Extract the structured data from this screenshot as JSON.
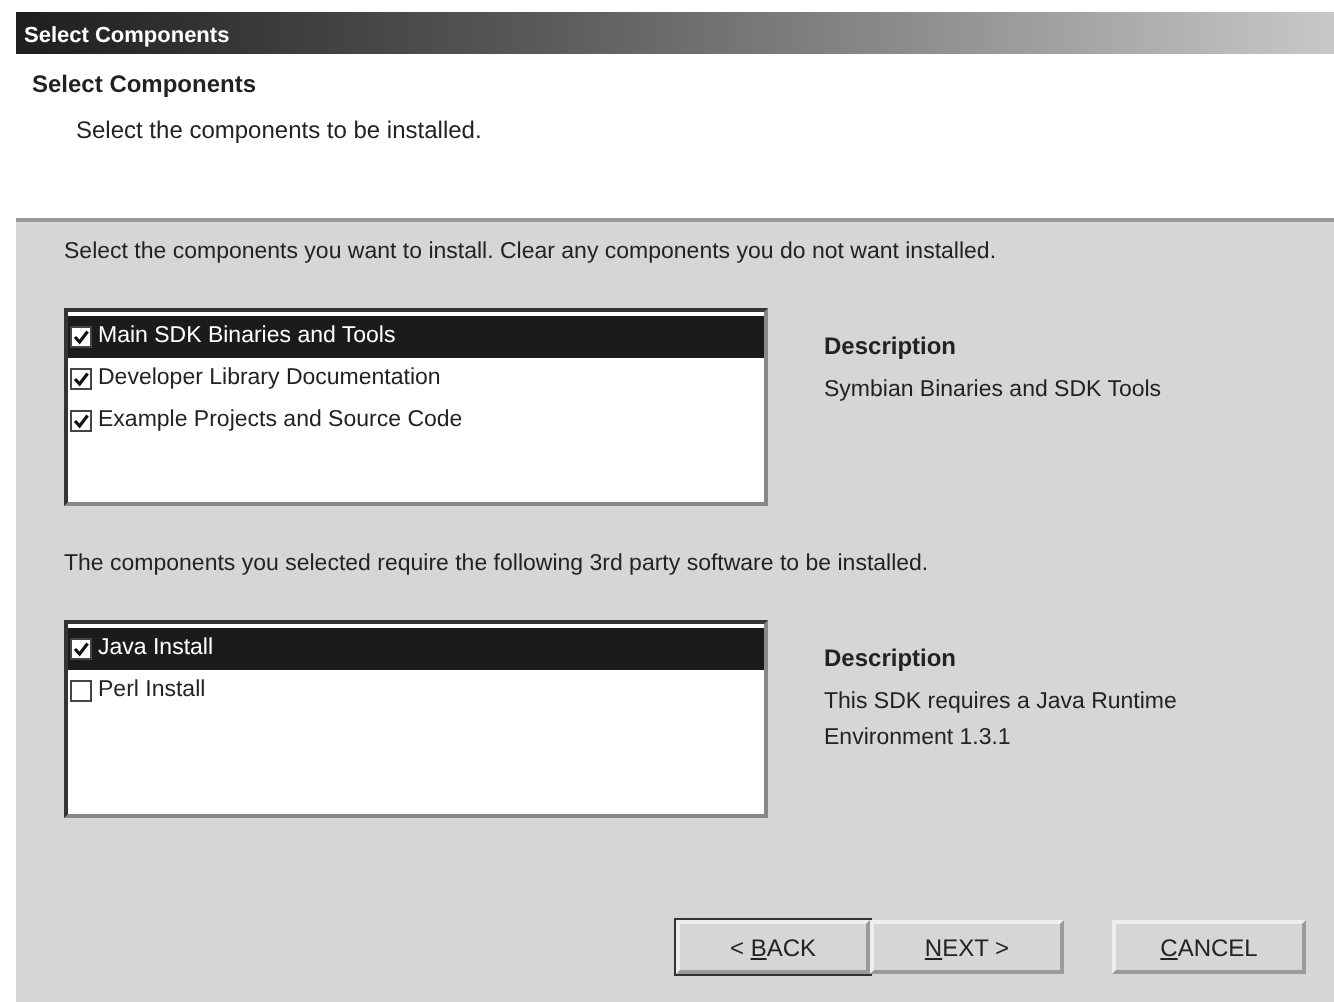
{
  "window": {
    "title": "Select Components"
  },
  "header": {
    "title": "Select Components",
    "subtitle": "Select the components to be installed."
  },
  "sections": [
    {
      "instruction": "Select the components you want to install. Clear any components you do not want installed.",
      "items": [
        {
          "label": "Main SDK Binaries and Tools",
          "checked": true,
          "selected": true
        },
        {
          "label": "Developer Library Documentation",
          "checked": true,
          "selected": false
        },
        {
          "label": "Example Projects and Source Code",
          "checked": true,
          "selected": false
        }
      ],
      "description_heading": "Description",
      "description": "Symbian Binaries and SDK Tools"
    },
    {
      "instruction": "The components you selected require the following 3rd party software to be installed.",
      "items": [
        {
          "label": "Java Install",
          "checked": true,
          "selected": true
        },
        {
          "label": "Perl Install",
          "checked": false,
          "selected": false
        }
      ],
      "description_heading": "Description",
      "description": "This SDK requires a Java Runtime Environment 1.3.1"
    }
  ],
  "buttons": [
    {
      "before": "< ",
      "mnemonic": "B",
      "after": "ACK",
      "kind": "default"
    },
    {
      "mnemonic": "N",
      "after": "EXT >",
      "kind": "normal"
    },
    {
      "mnemonic": "C",
      "after": "ANCEL",
      "kind": "normal"
    }
  ]
}
